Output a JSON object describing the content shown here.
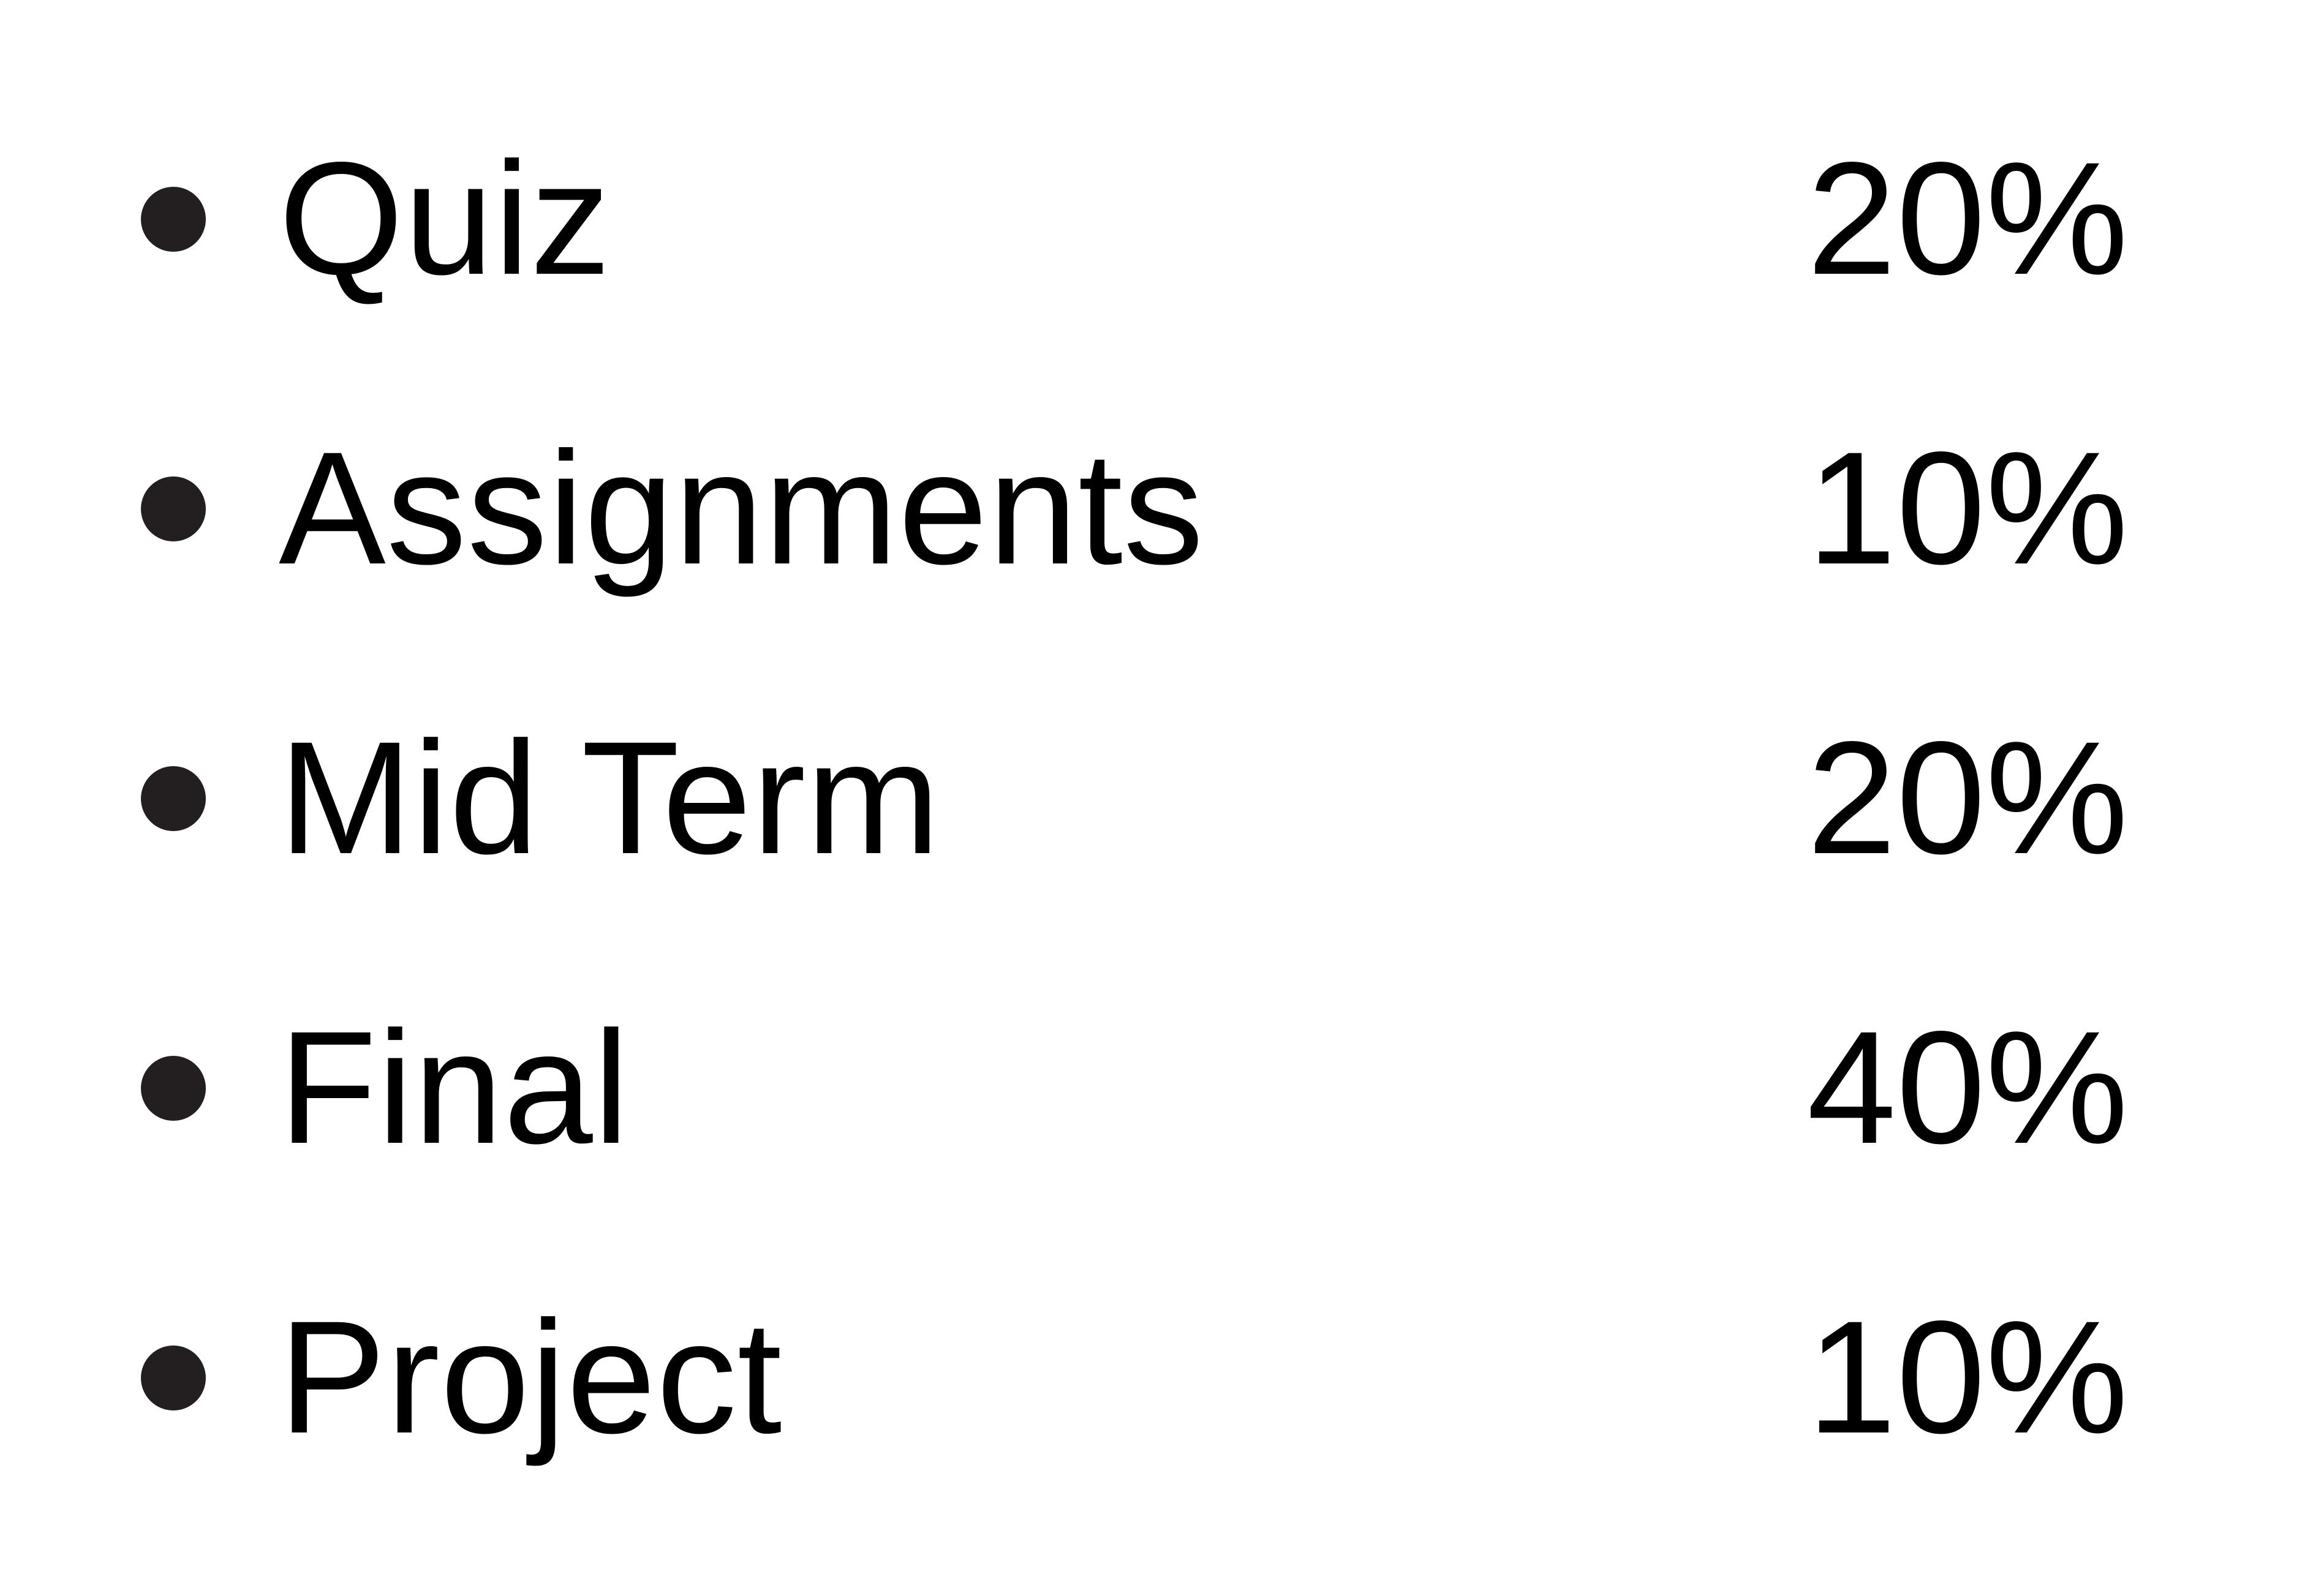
{
  "grade_breakdown": {
    "bullet_color": "#231f20",
    "text_color": "#000000",
    "items": [
      {
        "label": "Quiz",
        "weight": "20%"
      },
      {
        "label": "Assignments",
        "weight": "10%"
      },
      {
        "label": "Mid Term",
        "weight": "20%"
      },
      {
        "label": "Final",
        "weight": "40%"
      },
      {
        "label": "Project",
        "weight": "10%"
      }
    ]
  }
}
